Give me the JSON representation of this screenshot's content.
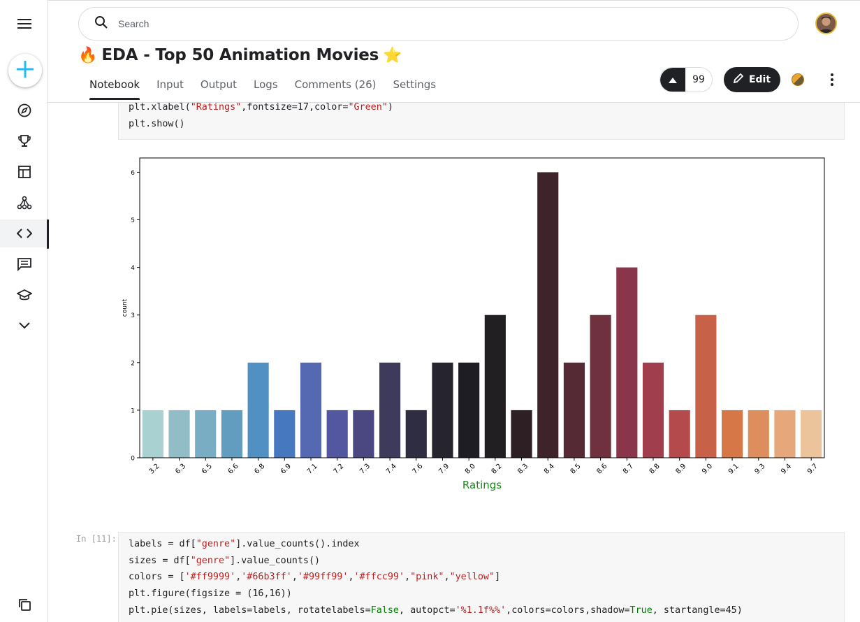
{
  "sidebar": {
    "items": [
      {
        "name": "menu-icon"
      },
      {
        "name": "create-icon"
      },
      {
        "name": "compass-icon",
        "label": "Explore"
      },
      {
        "name": "trophy-icon",
        "label": "Competitions"
      },
      {
        "name": "table-icon",
        "label": "Datasets"
      },
      {
        "name": "models-icon",
        "label": "Models"
      },
      {
        "name": "code-icon",
        "label": "Code"
      },
      {
        "name": "discussion-icon",
        "label": "Discussions"
      },
      {
        "name": "learn-icon",
        "label": "Learn"
      },
      {
        "name": "chevron-down-icon",
        "label": "More"
      },
      {
        "name": "copy-icon"
      }
    ]
  },
  "header": {
    "search_placeholder": "Search",
    "title": "EDA - Top 50 Animation Movies",
    "title_emoji_left": "🔥",
    "title_emoji_right": "⭐",
    "tabs": [
      "Notebook",
      "Input",
      "Output",
      "Logs",
      "Comments (26)",
      "Settings"
    ],
    "active_tab": "Notebook",
    "vote_count": "99",
    "edit_label": "Edit"
  },
  "cells": {
    "top_code": [
      [
        {
          "t": "plt.xlabel(",
          "c": ""
        },
        {
          "t": "\"Ratings\"",
          "c": "s"
        },
        {
          "t": ",fontsize=17,color=",
          "c": ""
        },
        {
          "t": "\"Green\"",
          "c": "s"
        },
        {
          "t": ")",
          "c": ""
        }
      ],
      [
        {
          "t": "plt.show()",
          "c": ""
        }
      ]
    ],
    "bottom_label": "In [11]:",
    "bottom_code": [
      [
        {
          "t": "labels = df[",
          "c": ""
        },
        {
          "t": "\"genre\"",
          "c": "s"
        },
        {
          "t": "].value_counts().index",
          "c": ""
        }
      ],
      [
        {
          "t": "sizes = df[",
          "c": ""
        },
        {
          "t": "\"genre\"",
          "c": "s"
        },
        {
          "t": "].value_counts()",
          "c": ""
        }
      ],
      [
        {
          "t": "colors = [",
          "c": ""
        },
        {
          "t": "'#ff9999'",
          "c": "s"
        },
        {
          "t": ",",
          "c": ""
        },
        {
          "t": "'#66b3ff'",
          "c": "s"
        },
        {
          "t": ",",
          "c": ""
        },
        {
          "t": "'#99ff99'",
          "c": "s"
        },
        {
          "t": ",",
          "c": ""
        },
        {
          "t": "'#ffcc99'",
          "c": "s"
        },
        {
          "t": ",",
          "c": ""
        },
        {
          "t": "\"pink\"",
          "c": "s"
        },
        {
          "t": ",",
          "c": ""
        },
        {
          "t": "\"yellow\"",
          "c": "s"
        },
        {
          "t": "]",
          "c": ""
        }
      ],
      [
        {
          "t": "plt.figure(figsize = (16,16))",
          "c": ""
        }
      ],
      [
        {
          "t": "plt.pie(sizes, labels=labels, rotatelabels=",
          "c": ""
        },
        {
          "t": "False",
          "c": "k"
        },
        {
          "t": ", autopct=",
          "c": ""
        },
        {
          "t": "'%1.1f%%'",
          "c": "s"
        },
        {
          "t": ",colors=colors,shadow=",
          "c": ""
        },
        {
          "t": "True",
          "c": "k"
        },
        {
          "t": ", startangle=45)",
          "c": ""
        }
      ]
    ]
  },
  "chart_data": {
    "type": "bar",
    "title": "",
    "xlabel": "Ratings",
    "ylabel": "count",
    "xlabel_color": "#1a8a1a",
    "ylim": [
      0,
      6.3
    ],
    "yticks": [
      0,
      1,
      2,
      3,
      4,
      5,
      6
    ],
    "grid": false,
    "categories": [
      "3.2",
      "6.3",
      "6.5",
      "6.6",
      "6.8",
      "6.9",
      "7.1",
      "7.2",
      "7.3",
      "7.4",
      "7.6",
      "7.9",
      "8.0",
      "8.2",
      "8.3",
      "8.4",
      "8.5",
      "8.6",
      "8.7",
      "8.8",
      "8.9",
      "9.0",
      "9.1",
      "9.3",
      "9.4",
      "9.7"
    ],
    "values": [
      1,
      1,
      1,
      1,
      2,
      1,
      2,
      1,
      1,
      2,
      1,
      2,
      2,
      3,
      1,
      6,
      2,
      3,
      4,
      2,
      1,
      3,
      1,
      1,
      1,
      1
    ],
    "colors": [
      "#a9d1d1",
      "#92bcc6",
      "#79adc4",
      "#629cbe",
      "#5090c3",
      "#4678c0",
      "#5569b3",
      "#5357a0",
      "#4b4780",
      "#3d3a5c",
      "#2e2d42",
      "#26242f",
      "#1f1d24",
      "#221f22",
      "#2e1f24",
      "#3e232b",
      "#562a35",
      "#70313f",
      "#8a3549",
      "#a13e4e",
      "#b44a4c",
      "#c76148",
      "#d67748",
      "#dd8e5c",
      "#e6a87a",
      "#ecc49b"
    ],
    "palette_name": "icefire"
  }
}
